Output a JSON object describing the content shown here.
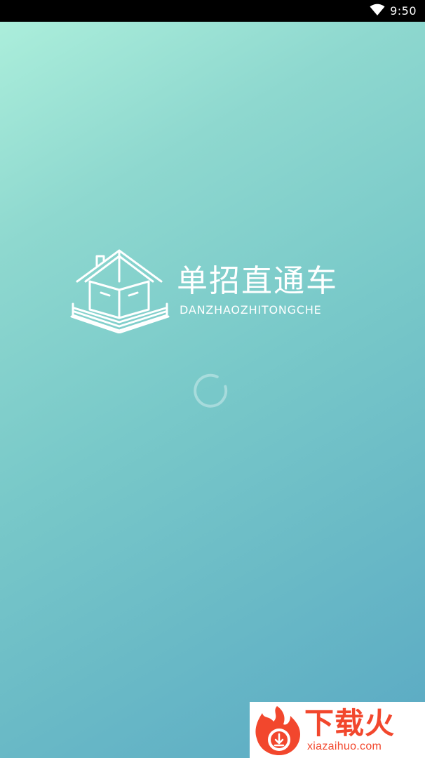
{
  "status_bar": {
    "time": "9:50",
    "wifi_icon": "wifi-icon"
  },
  "splash": {
    "app_title": "单招直通车",
    "app_subtitle": "DANZHAOZHITONGCHE",
    "logo_icon": "house-book-icon",
    "loading_icon": "spinner-icon"
  },
  "watermark": {
    "brand": "下载火",
    "url": "xiazaihuo.com",
    "logo_icon": "flame-download-icon",
    "brand_color": "#f2472d"
  },
  "colors": {
    "gradient_start": "#aef0dc",
    "gradient_end": "#5aa9c4"
  }
}
